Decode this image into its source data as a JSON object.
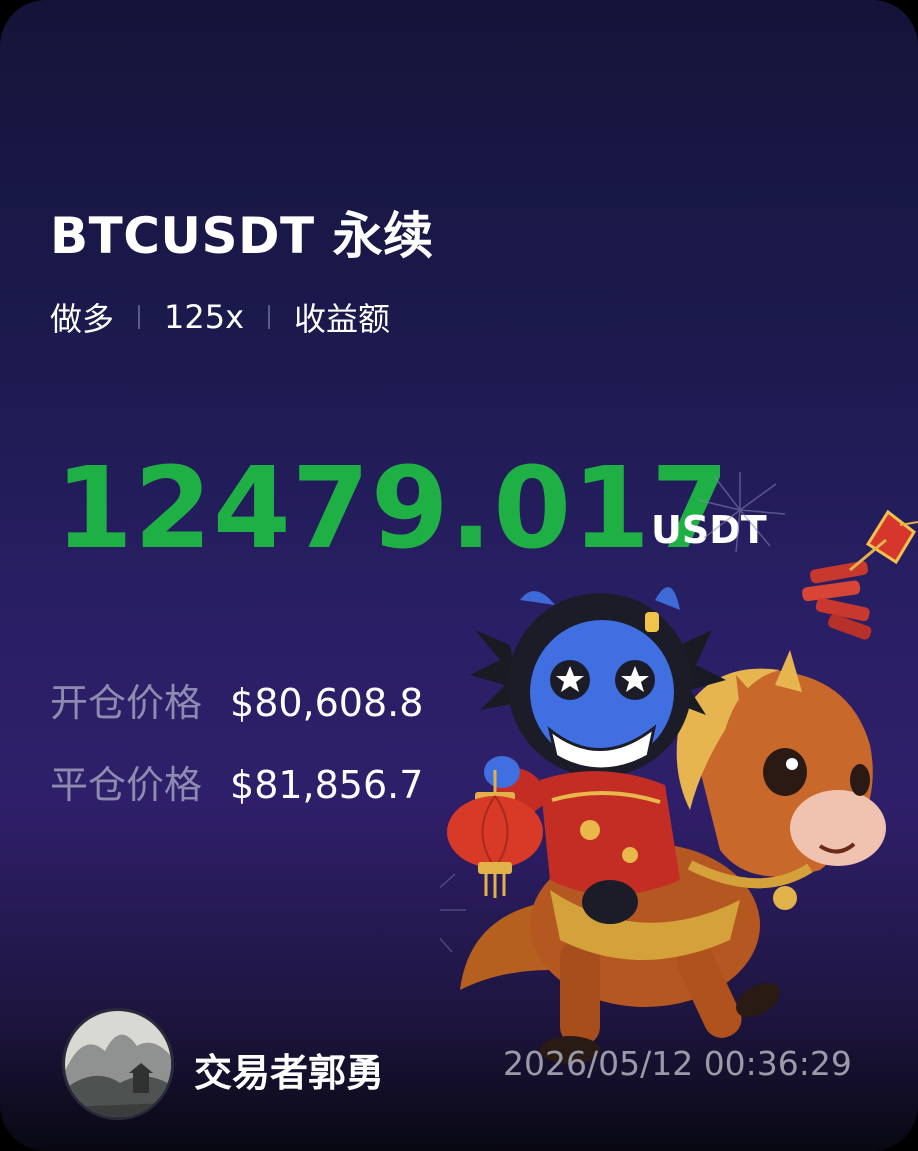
{
  "card": {
    "symbol": "BTCUSDT",
    "contract": "永续",
    "side": "做多",
    "leverage": "125x",
    "metric": "收益额",
    "pnl": "12479.017",
    "unit": "USDT",
    "open_label": "开仓价格",
    "open_price": "$80,608.8",
    "close_label": "平仓价格",
    "close_price": "$81,856.7"
  },
  "footer": {
    "trader": "交易者郭勇",
    "timestamp": "2026/05/12 00:36:29"
  },
  "colors": {
    "profit": "#1fb045",
    "background": "#1c1a4e",
    "label": "#8d8cb0"
  },
  "icons": [
    "avatar-landscape-icon",
    "mascot-illustration",
    "horse-illustration",
    "lantern-icon",
    "firecracker-icon",
    "firework-icon"
  ]
}
